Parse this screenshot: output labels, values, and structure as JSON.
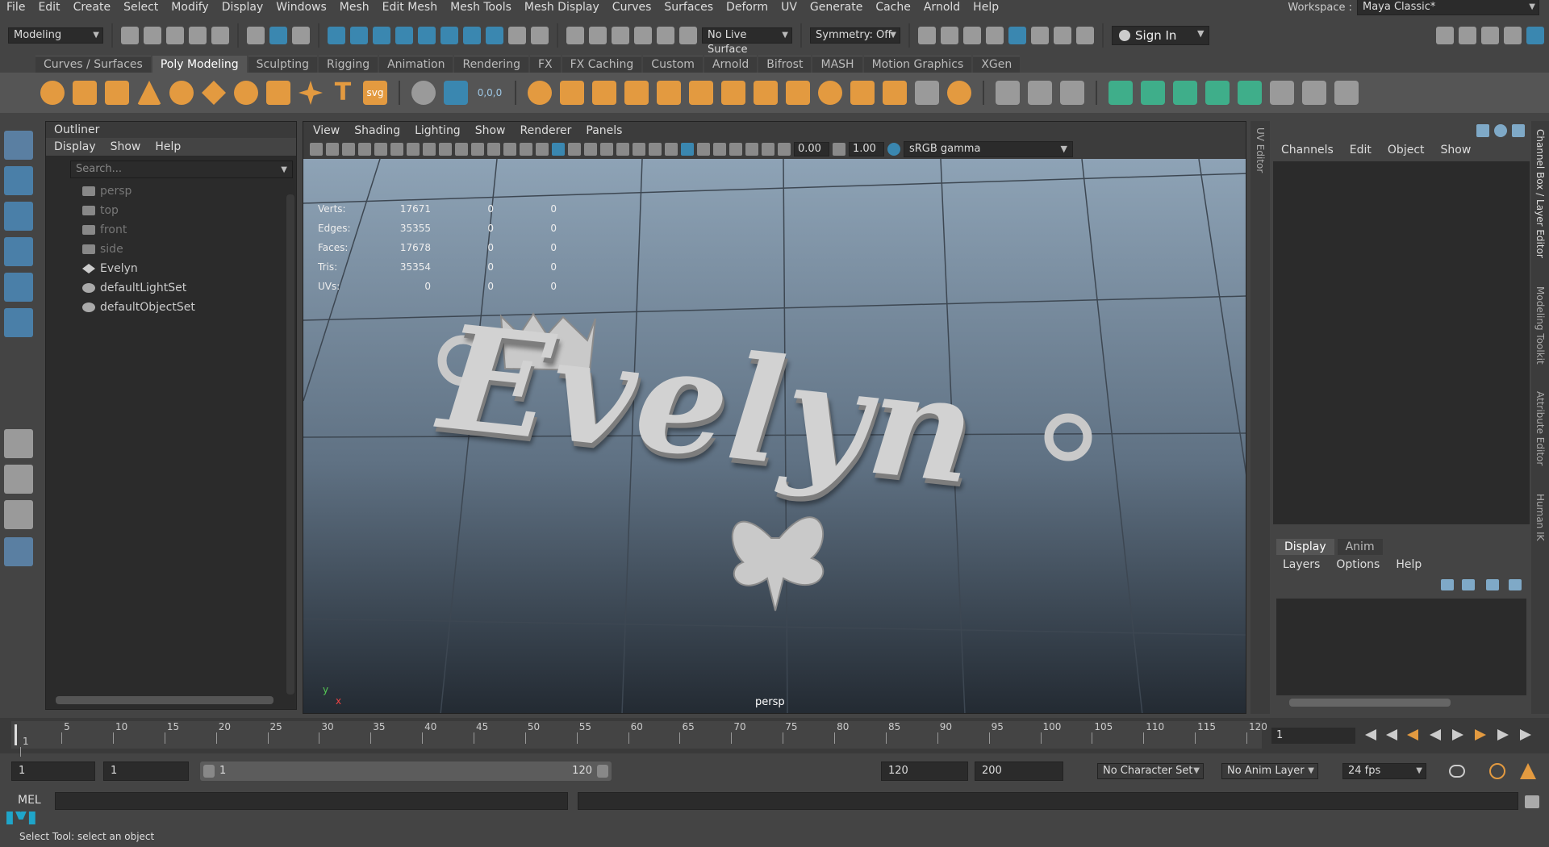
{
  "menubar": {
    "items": [
      "File",
      "Edit",
      "Create",
      "Select",
      "Modify",
      "Display",
      "Windows",
      "Mesh",
      "Edit Mesh",
      "Mesh Tools",
      "Mesh Display",
      "Curves",
      "Surfaces",
      "Deform",
      "UV",
      "Generate",
      "Cache",
      "Arnold",
      "Help"
    ],
    "workspace_label": "Workspace :",
    "workspace_value": "Maya Classic*"
  },
  "statusline": {
    "mode": "Modeling",
    "live_surface": "No Live Surface",
    "symmetry": "Symmetry: Off",
    "sign_in": "Sign In"
  },
  "shelf": {
    "tabs": [
      "Curves / Surfaces",
      "Poly Modeling",
      "Sculpting",
      "Rigging",
      "Animation",
      "Rendering",
      "FX",
      "FX Caching",
      "Custom",
      "Arnold",
      "Bifrost",
      "MASH",
      "Motion Graphics",
      "XGen"
    ],
    "active_tab": "Poly Modeling",
    "svg_label": "svg",
    "coord_label": "0,0,0"
  },
  "outliner": {
    "title": "Outliner",
    "menu": [
      "Display",
      "Show",
      "Help"
    ],
    "search_placeholder": "Search...",
    "items": [
      {
        "label": "persp",
        "dim": true
      },
      {
        "label": "top",
        "dim": true
      },
      {
        "label": "front",
        "dim": true
      },
      {
        "label": "side",
        "dim": true
      },
      {
        "label": "Evelyn",
        "dim": false
      },
      {
        "label": "defaultLightSet",
        "dim": false
      },
      {
        "label": "defaultObjectSet",
        "dim": false
      }
    ]
  },
  "viewport": {
    "menu": [
      "View",
      "Shading",
      "Lighting",
      "Show",
      "Renderer",
      "Panels"
    ],
    "field1": "0.00",
    "field2": "1.00",
    "color_space": "sRGB gamma",
    "hud": [
      {
        "label": "Verts:",
        "a": "17671",
        "b": "0",
        "c": "0"
      },
      {
        "label": "Edges:",
        "a": "35355",
        "b": "0",
        "c": "0"
      },
      {
        "label": "Faces:",
        "a": "17678",
        "b": "0",
        "c": "0"
      },
      {
        "label": "Tris:",
        "a": "35354",
        "b": "0",
        "c": "0"
      },
      {
        "label": "UVs:",
        "a": "0",
        "b": "0",
        "c": "0"
      }
    ],
    "model_text": "Evelyn",
    "camera": "persp",
    "axis_x": "x",
    "axis_y": "y"
  },
  "side_tabs": {
    "uv_editor": "UV Editor",
    "channel_box": "Channel Box / Layer Editor",
    "modeling_toolkit": "Modeling Toolkit",
    "attribute_editor": "Attribute Editor",
    "human_ik": "Human IK"
  },
  "channelbox": {
    "menu": [
      "Channels",
      "Edit",
      "Object",
      "Show"
    ],
    "tabs": [
      "Display",
      "Anim"
    ],
    "active_tab": "Display",
    "layer_menu": [
      "Layers",
      "Options",
      "Help"
    ]
  },
  "timeslider": {
    "ticks": [
      "1",
      "5",
      "10",
      "15",
      "20",
      "25",
      "30",
      "35",
      "40",
      "45",
      "50",
      "55",
      "60",
      "65",
      "70",
      "75",
      "80",
      "85",
      "90",
      "95",
      "100",
      "105",
      "110",
      "115",
      "120"
    ],
    "current_frame": "1"
  },
  "rangeslider": {
    "start": "1",
    "playback_start": "1",
    "range_start": "1",
    "range_end": "120",
    "playback_end": "120",
    "end": "200",
    "character_set": "No Character Set",
    "anim_layer": "No Anim Layer",
    "fps": "24 fps"
  },
  "cmdline": {
    "label": "MEL"
  },
  "helpline": {
    "text": "Select Tool: select an object"
  },
  "colors": {
    "accent": "#5a7fa2",
    "shelf_orange": "#e39a40",
    "maya_blue": "#1fa5c9"
  }
}
